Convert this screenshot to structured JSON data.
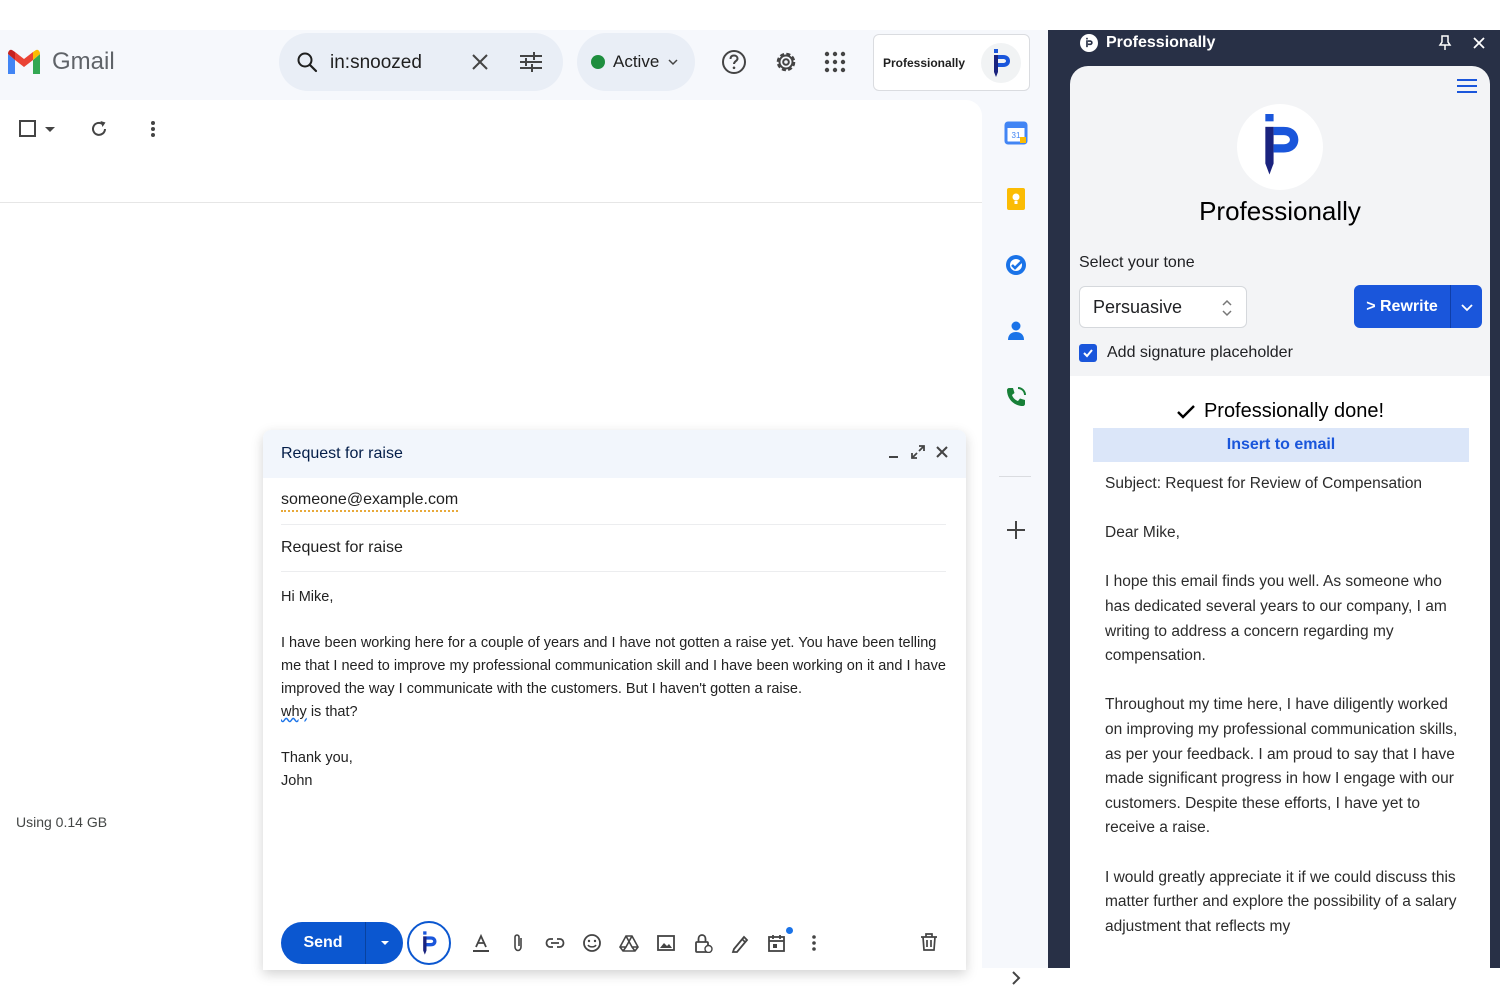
{
  "gmail": {
    "logo_text": "Gmail",
    "search_query": "in:snoozed",
    "status": "Active",
    "addon_label": "Professionally",
    "storage": "Using 0.14 GB"
  },
  "compose": {
    "title": "Request for raise",
    "to": "someone@example.com",
    "subject": "Request for raise",
    "body": {
      "greeting": "Hi Mike,",
      "paragraph": "I have been working here for a couple of years and I have not gotten a raise yet. You have been telling me that I need to improve my professional communication skill and I have been working on it and I have improved the way I communicate with the customers. But I haven't gotten a raise.",
      "question_lead": "why",
      "question_rest": " is that?",
      "closing": "Thank you,",
      "signature": "John"
    },
    "send_label": "Send"
  },
  "side_panel": {
    "title": "Professionally",
    "brand_name": "Professionally",
    "tone_label": "Select your tone",
    "tone_value": "Persuasive",
    "rewrite_label": "> Rewrite",
    "signature_label": "Add signature placeholder",
    "done_label": "Professionally done!",
    "insert_label": "Insert to email",
    "reply": {
      "subject": "Subject: Request for Review of Compensation",
      "greeting": "Dear Mike,",
      "p1": "I hope this email finds you well. As someone who has dedicated several years to our company, I am writing to address a concern regarding my compensation.",
      "p2": "Throughout my time here, I have diligently worked on improving my professional communication skills, as per your feedback. I am proud to say that I have made significant progress in how I engage with our customers. Despite these efforts, I have yet to receive a raise.",
      "p3": "I would greatly appreciate it if we could discuss this matter further and explore the possibility of a salary adjustment that reflects my"
    }
  },
  "colors": {
    "gmail_bg": "#f6f8fc",
    "accent_blue": "#0b57d0",
    "panel_dark": "#283046",
    "rewrite_blue": "#1a56db",
    "active_green": "#1e8e3e"
  }
}
